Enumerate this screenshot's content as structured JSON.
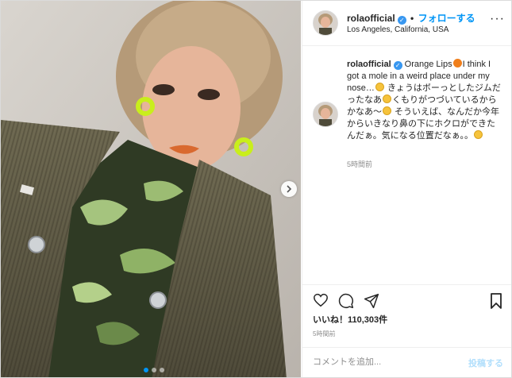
{
  "post": {
    "username": "rolaofficial",
    "verified_badge": "✓",
    "separator": "•",
    "follow_label": "フォローする",
    "location": "Los Angeles, California, USA",
    "more_label": "···"
  },
  "caption": {
    "username": "rolaofficial",
    "part1": " Orange Lips",
    "part2": "I think I got a mole in a weird place under my nose…",
    "part3": " きょうはボーっとしたジムだったなあ",
    "part4": "くもりがつづいているからかなあ〜",
    "part5": " そういえば、なんだか今年からいきなり鼻の下にホクロができたんだぁ。気になる位置だなぁ。。",
    "time": "5時間前"
  },
  "engagement": {
    "likes": "いいね！110,303件",
    "time": "5時間前"
  },
  "comment": {
    "placeholder": "コメントを追加...",
    "post_label": "投稿する"
  },
  "colors": {
    "accent": "#0095f6",
    "verified": "#3897f0",
    "border": "#dbdbdb",
    "muted": "#8e8e8e"
  },
  "icons": [
    "heart-icon",
    "comment-icon",
    "share-icon",
    "bookmark-icon",
    "chevron-right-icon",
    "verified-icon",
    "more-icon"
  ],
  "carousel": {
    "count": 3,
    "active": 1
  }
}
